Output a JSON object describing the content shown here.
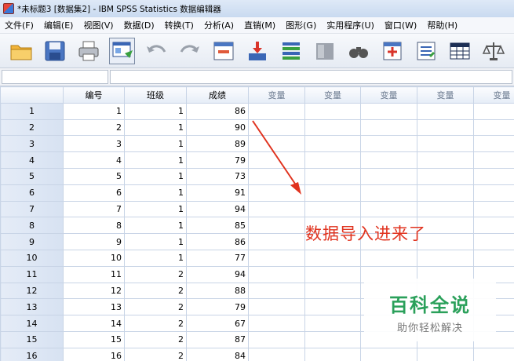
{
  "window": {
    "title": "*未标题3 [数据集2] - IBM SPSS Statistics 数据编辑器"
  },
  "menu": [
    "文件(F)",
    "编辑(E)",
    "视图(V)",
    "数据(D)",
    "转换(T)",
    "分析(A)",
    "直销(M)",
    "图形(G)",
    "实用程序(U)",
    "窗口(W)",
    "帮助(H)"
  ],
  "toolbar": [
    "open-icon",
    "save-icon",
    "print-icon",
    "dialog-recall-icon",
    "undo-icon",
    "redo-icon",
    "goto-case-icon",
    "goto-variable-icon",
    "variables-icon",
    "run-descriptive-icon",
    "find-icon",
    "insert-cases-icon",
    "insert-variable-icon",
    "split-file-icon",
    "weight-cases-icon"
  ],
  "editor": {
    "cell_ref": "",
    "cell_value": ""
  },
  "grid": {
    "columns": [
      "编号",
      "班级",
      "成绩",
      "变量",
      "变量",
      "变量",
      "变量",
      "变量"
    ],
    "rows": [
      {
        "n": "1",
        "c": [
          "1",
          "1",
          "86"
        ]
      },
      {
        "n": "2",
        "c": [
          "2",
          "1",
          "90"
        ]
      },
      {
        "n": "3",
        "c": [
          "3",
          "1",
          "89"
        ]
      },
      {
        "n": "4",
        "c": [
          "4",
          "1",
          "79"
        ]
      },
      {
        "n": "5",
        "c": [
          "5",
          "1",
          "73"
        ]
      },
      {
        "n": "6",
        "c": [
          "6",
          "1",
          "91"
        ]
      },
      {
        "n": "7",
        "c": [
          "7",
          "1",
          "94"
        ]
      },
      {
        "n": "8",
        "c": [
          "8",
          "1",
          "85"
        ]
      },
      {
        "n": "9",
        "c": [
          "9",
          "1",
          "86"
        ]
      },
      {
        "n": "10",
        "c": [
          "10",
          "1",
          "77"
        ]
      },
      {
        "n": "11",
        "c": [
          "11",
          "2",
          "94"
        ]
      },
      {
        "n": "12",
        "c": [
          "12",
          "2",
          "88"
        ]
      },
      {
        "n": "13",
        "c": [
          "13",
          "2",
          "79"
        ]
      },
      {
        "n": "14",
        "c": [
          "14",
          "2",
          "67"
        ]
      },
      {
        "n": "15",
        "c": [
          "15",
          "2",
          "87"
        ]
      },
      {
        "n": "16",
        "c": [
          "16",
          "2",
          "84"
        ]
      }
    ]
  },
  "annotation": {
    "text": "数据导入进来了",
    "color": "#e0321e"
  },
  "watermark": {
    "title": "百科全说",
    "subtitle": "助你轻松解决"
  }
}
